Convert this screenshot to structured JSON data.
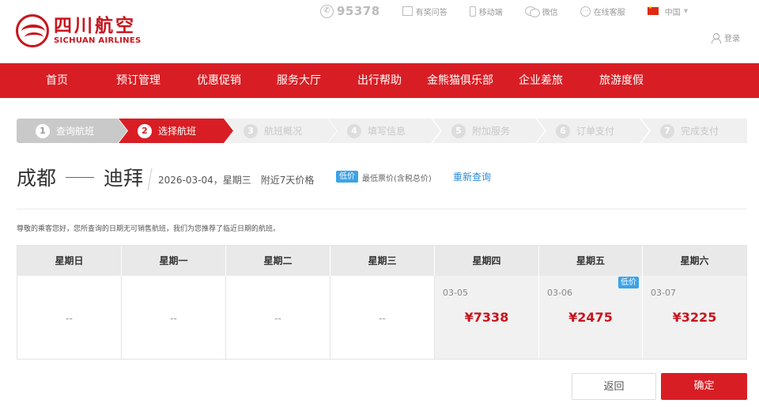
{
  "logo": {
    "cn": "四川航空",
    "en": "SICHUAN AIRLINES"
  },
  "util": {
    "phone": "95378",
    "qa": "有奖问答",
    "mobile": "移动端",
    "wechat": "微信",
    "service": "在线客服",
    "region": "中国",
    "login": "登录"
  },
  "nav": [
    "首页",
    "预订管理",
    "优惠促销",
    "服务大厅",
    "出行帮助",
    "金熊猫俱乐部",
    "企业差旅",
    "旅游度假"
  ],
  "steps": [
    {
      "num": "1",
      "label": "查询航班",
      "state": "done"
    },
    {
      "num": "2",
      "label": "选择航班",
      "state": "active"
    },
    {
      "num": "3",
      "label": "航班概况",
      "state": "pending"
    },
    {
      "num": "4",
      "label": "填写信息",
      "state": "pending"
    },
    {
      "num": "5",
      "label": "附加服务",
      "state": "pending"
    },
    {
      "num": "6",
      "label": "订单支付",
      "state": "pending"
    },
    {
      "num": "7",
      "label": "完成支付",
      "state": "pending"
    }
  ],
  "route": {
    "from": "成都",
    "to": "迪拜",
    "date": "2026-03-04，星期三",
    "note": "附近7天价格",
    "low_tag": "低价",
    "low_desc": "最低票价(含税总价)",
    "requery": "重新查询"
  },
  "notice": "尊敬的乘客您好，您所查询的日期无可销售航班，我们为您推荐了临近日期的航班。",
  "calendar": {
    "headers": [
      "星期日",
      "星期一",
      "星期二",
      "星期三",
      "星期四",
      "星期五",
      "星期六"
    ],
    "cells": [
      {
        "empty": "--"
      },
      {
        "empty": "--"
      },
      {
        "empty": "--"
      },
      {
        "empty": "--"
      },
      {
        "date": "03-05",
        "price": "¥7338",
        "tag": ""
      },
      {
        "date": "03-06",
        "price": "¥2475",
        "tag": "低价"
      },
      {
        "date": "03-07",
        "price": "¥3225",
        "tag": ""
      }
    ]
  },
  "buttons": {
    "back": "返回",
    "ok": "确定"
  }
}
